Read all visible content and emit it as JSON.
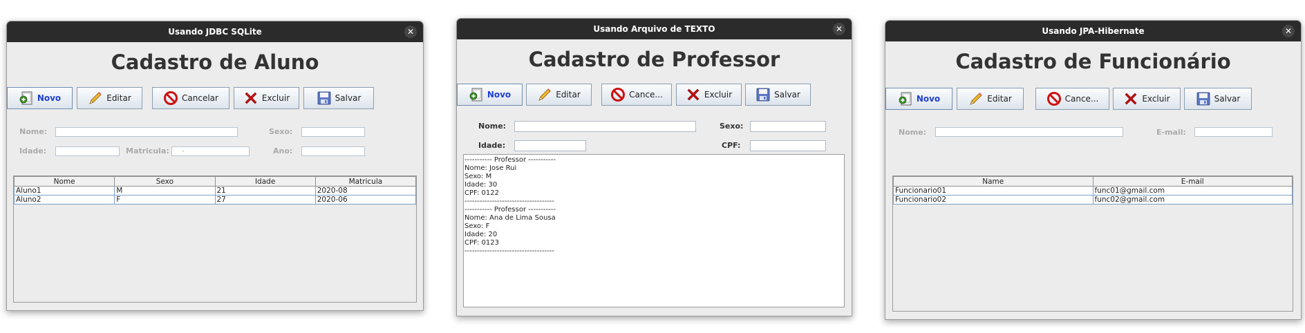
{
  "win1": {
    "title": "Usando JDBC SQLite",
    "heading": "Cadastro de Aluno",
    "buttons": {
      "novo": "Novo",
      "editar": "Editar",
      "cancelar": "Cancelar",
      "excluir": "Excluir",
      "salvar": "Salvar"
    },
    "labels": {
      "nome": "Nome:",
      "sexo": "Sexo:",
      "idade": "Idade:",
      "matricula": "Matricula:",
      "ano": "Ano:"
    },
    "matricula_value": "-",
    "table": {
      "headers": [
        "Nome",
        "Sexo",
        "Idade",
        "Matricula"
      ],
      "rows": [
        [
          "Aluno1",
          "M",
          "21",
          "2020-08"
        ],
        [
          "Aluno2",
          "F",
          "27",
          "2020-06"
        ]
      ]
    }
  },
  "win2": {
    "title": "Usando Arquivo de TEXTO",
    "heading": "Cadastro de Professor",
    "buttons": {
      "novo": "Novo",
      "editar": "Editar",
      "cancelar": "Cance...",
      "excluir": "Excluir",
      "salvar": "Salvar"
    },
    "labels": {
      "nome": "Nome:",
      "sexo": "Sexo:",
      "idade": "Idade:",
      "cpf": "CPF:"
    },
    "text_lines": [
      "----------- Professor -----------",
      "Nome: Jose Rui",
      "Sexo: M",
      "Idade: 30",
      "CPF: 0122",
      "------------------------------------",
      "----------- Professor -----------",
      "Nome: Ana de Lima Sousa",
      "Sexo: F",
      "Idade: 20",
      "CPF: 0123",
      "------------------------------------"
    ]
  },
  "win3": {
    "title": "Usando JPA-Hibernate",
    "heading": "Cadastro de Funcionário",
    "buttons": {
      "novo": "Novo",
      "editar": "Editar",
      "cancelar": "Cance...",
      "excluir": "Excluir",
      "salvar": "Salvar"
    },
    "labels": {
      "nome": "Nome:",
      "email": "E-mail:"
    },
    "table": {
      "headers": [
        "Name",
        "E-mail"
      ],
      "rows": [
        [
          "Funcionario01",
          "func01@gmail.com"
        ],
        [
          "Funcionario02",
          "func02@gmail.com"
        ]
      ]
    }
  },
  "icons": {
    "novo": "new-document-icon",
    "editar": "pencil-icon",
    "cancelar": "no-entry-icon",
    "excluir": "red-x-icon",
    "salvar": "floppy-disk-icon"
  },
  "colors": {
    "titlebar": "#2b2b2b",
    "window_bg": "#ececec",
    "primary_text": "#1f3fd0",
    "cancel_red": "#cc1111",
    "delete_red": "#c41010"
  }
}
